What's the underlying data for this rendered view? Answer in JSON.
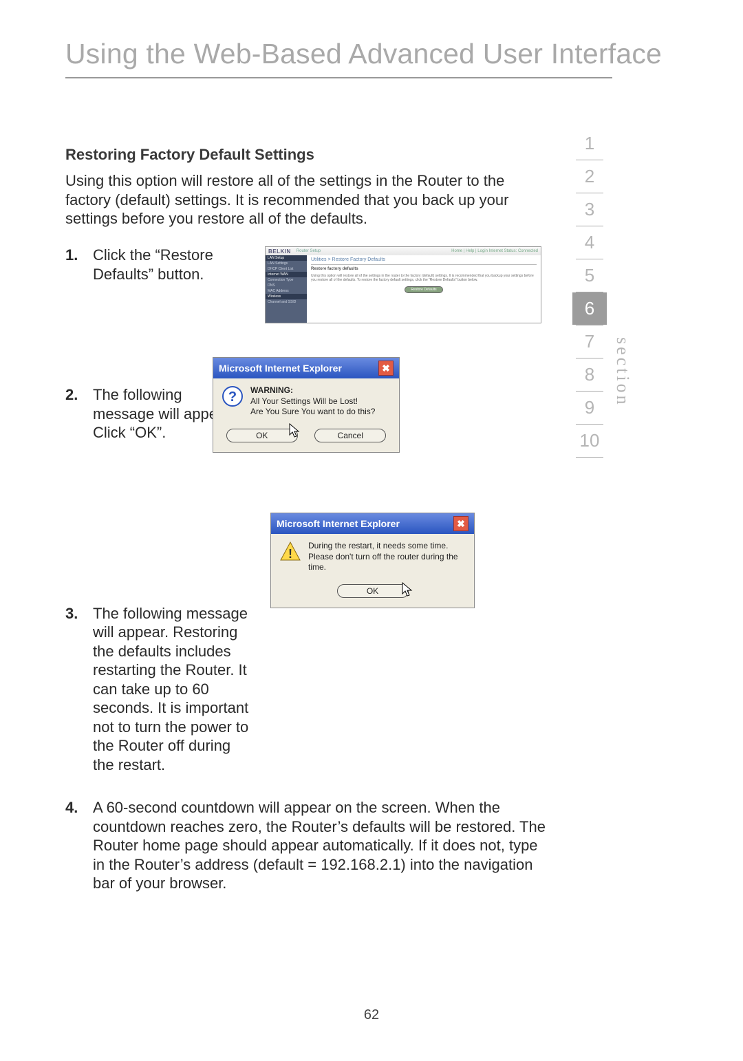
{
  "title": "Using the Web-Based Advanced User Interface",
  "subtitle": "Restoring Factory Default Settings",
  "intro": "Using this option will restore all of the settings in the Router to the factory (default) settings. It is recommended that you back up your settings before you restore all of the defaults.",
  "steps": {
    "s1": {
      "num": "1.",
      "text": "Click the “Restore Defaults” button."
    },
    "s2": {
      "num": "2.",
      "text": "The following message will appear. Click “OK”."
    },
    "s3": {
      "num": "3.",
      "text": "The following message will appear. Restoring the defaults includes restarting the Router. It can take up to 60 seconds. It is important not to turn the power to the Router off during the restart."
    },
    "s4": {
      "num": "4.",
      "text": "A 60-second countdown will appear on the screen. When the countdown reaches zero, the Router’s defaults will be restored. The Router home page should appear automatically. If it does not, type in the Router’s address (default = 192.168.2.1) into the navigation bar of your browser."
    }
  },
  "page_number": "62",
  "section_label": "section",
  "section_nav": {
    "items": [
      "1",
      "2",
      "3",
      "4",
      "5",
      "6",
      "7",
      "8",
      "9",
      "10"
    ],
    "active_index": 5
  },
  "screenshot1": {
    "brand": "BELKIN",
    "toolbar_text": "Router Setup",
    "home_help": "Home | Help | Login   Internet Status: Connected",
    "breadcrumb": "Utilities > Restore Factory Defaults",
    "section_title": "Restore factory defaults",
    "paragraph": "Using this option will restore all of the settings in the router to the factory (default) settings. It is recommended that you backup your settings before you restore all of the defaults. To restore the factory default settings, click the “Restore Defaults” button below.",
    "button": "Restore Defaults",
    "sidebar": [
      "LAN Setup",
      "LAN Settings",
      "DHCP Client List",
      "Internet WAN",
      "Connection Type",
      "DNS",
      "MAC Address",
      "Wireless",
      "Channel and SSID"
    ]
  },
  "dialog2": {
    "title": "Microsoft Internet Explorer",
    "close": "✖",
    "msg_header": "WARNING:",
    "msg_line1": "All Your Settings Will be Lost!",
    "msg_line2": "Are You Sure You want to do this?",
    "ok": "OK",
    "cancel": "Cancel"
  },
  "dialog3": {
    "title": "Microsoft Internet Explorer",
    "close": "✖",
    "msg_line1": "During the restart, it needs some time.",
    "msg_line2": "Please don't turn off the router during the time.",
    "ok": "OK"
  }
}
